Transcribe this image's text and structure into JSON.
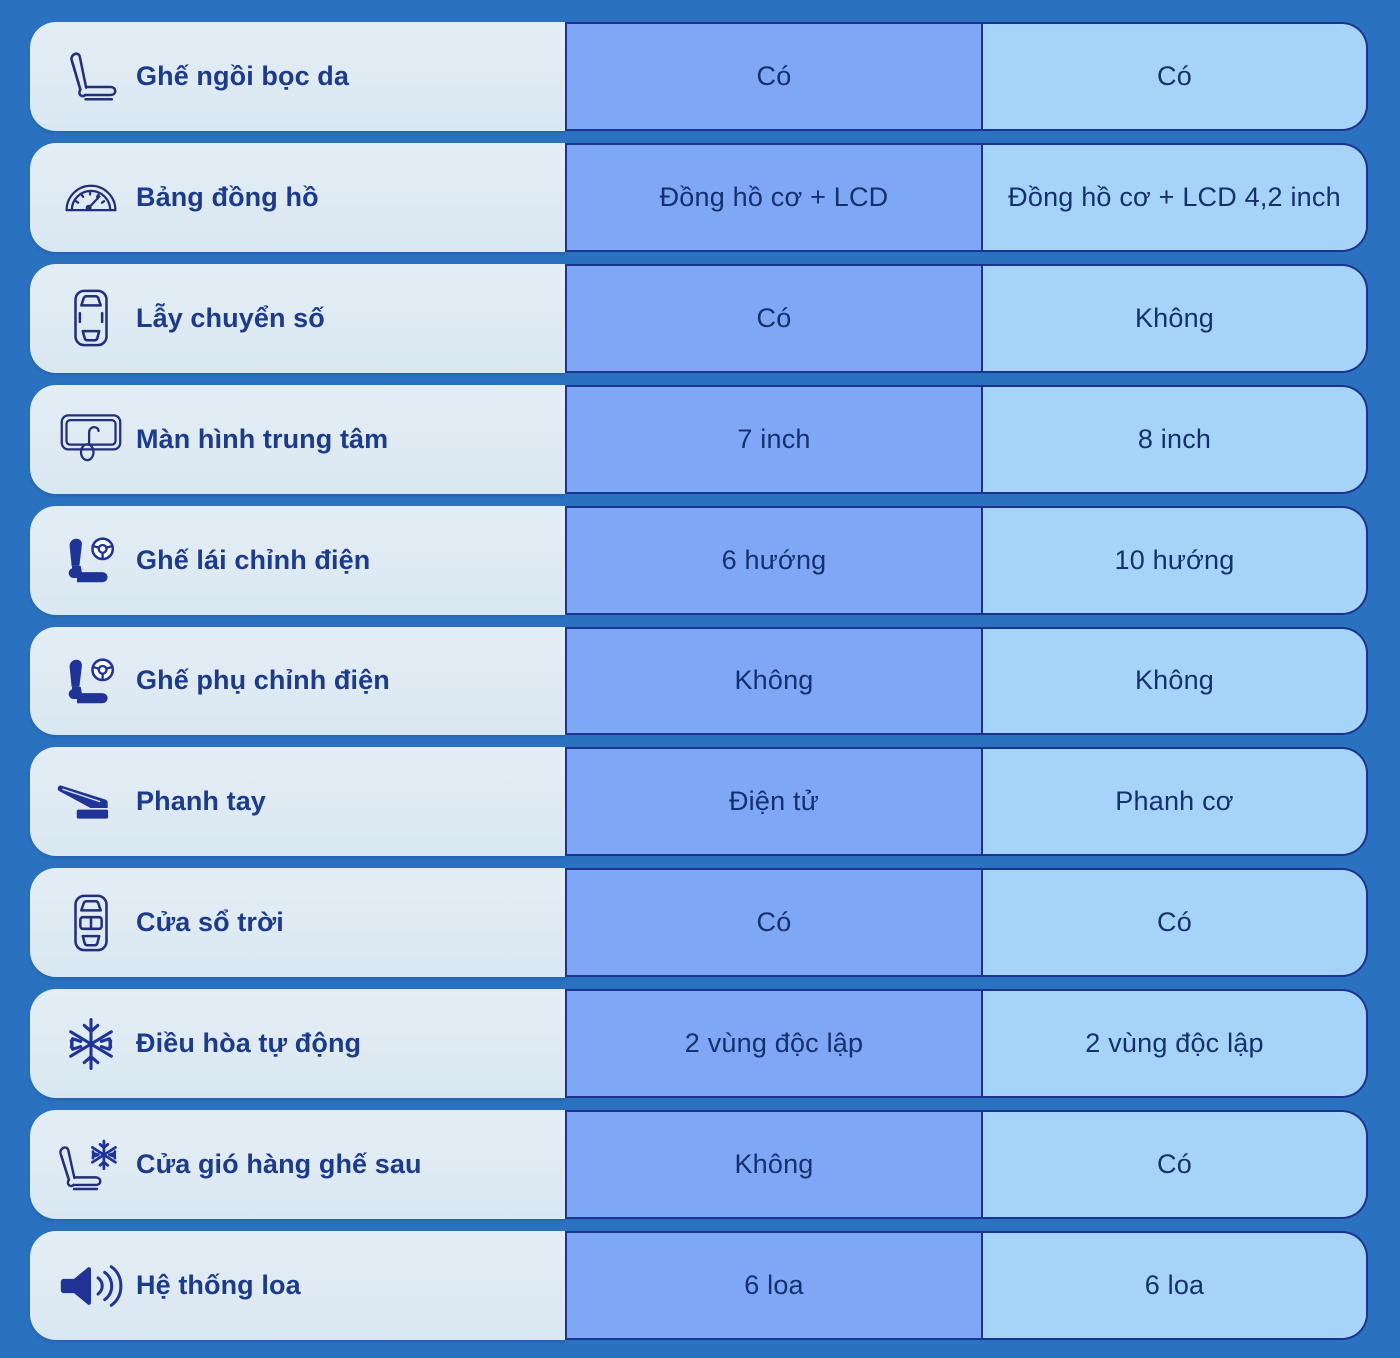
{
  "theme": {
    "background": "#2a72c0",
    "feature_cell_bg": "#dfeaf3",
    "variant_a_bg": "#7ea7f5",
    "variant_b_bg": "#a6d4f8",
    "border": "#1c3490",
    "label_color": "#1d3b8b",
    "value_color": "#16306e"
  },
  "comparison": {
    "rows": [
      {
        "icon": "car-seat-icon",
        "feature": "Ghế ngồi bọc da",
        "variant_a": "Có",
        "variant_b": "Có"
      },
      {
        "icon": "speedometer-icon",
        "feature": "Bảng đồng hồ",
        "variant_a": "Đồng hồ cơ + LCD",
        "variant_b": "Đồng hồ cơ + LCD 4,2 inch"
      },
      {
        "icon": "car-top-view-icon",
        "feature": "Lẫy chuyển số",
        "variant_a": "Có",
        "variant_b": "Không"
      },
      {
        "icon": "center-display-icon",
        "feature": "Màn hình trung tâm",
        "variant_a": "7 inch",
        "variant_b": "8 inch"
      },
      {
        "icon": "driver-seat-power-icon",
        "feature": "Ghế lái chỉnh điện",
        "variant_a": "6 hướng",
        "variant_b": "10 hướng"
      },
      {
        "icon": "passenger-seat-power-icon",
        "feature": "Ghế phụ chỉnh điện",
        "variant_a": "Không",
        "variant_b": "Không"
      },
      {
        "icon": "handbrake-icon",
        "feature": "Phanh tay",
        "variant_a": "Điện tử",
        "variant_b": "Phanh cơ"
      },
      {
        "icon": "sunroof-car-icon",
        "feature": "Cửa sổ trời",
        "variant_a": "Có",
        "variant_b": "Có"
      },
      {
        "icon": "snowflake-icon",
        "feature": "Điều hòa tự động",
        "variant_a": "2 vùng độc lập",
        "variant_b": "2 vùng độc lập"
      },
      {
        "icon": "rear-seat-vent-icon",
        "feature": "Cửa gió hàng ghế sau",
        "variant_a": "Không",
        "variant_b": "Có"
      },
      {
        "icon": "speaker-icon",
        "feature": "Hệ thống loa",
        "variant_a": "6 loa",
        "variant_b": "6 loa"
      }
    ]
  }
}
